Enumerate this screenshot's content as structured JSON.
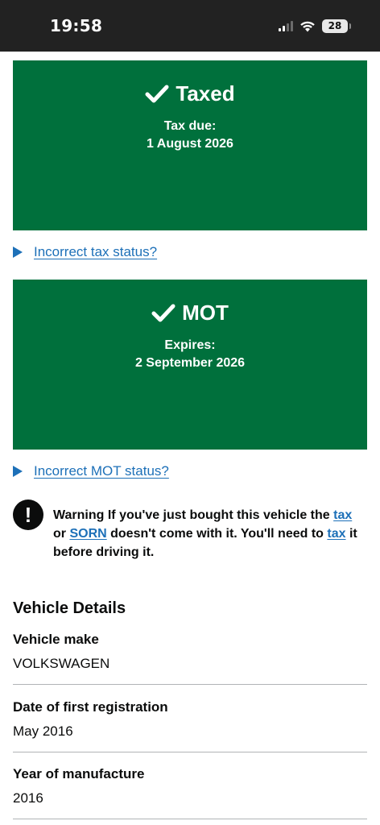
{
  "status_bar": {
    "time": "19:58",
    "battery": "28"
  },
  "tax_panel": {
    "title": "Taxed",
    "label": "Tax due:",
    "date": "1 August 2026"
  },
  "tax_link": "Incorrect tax status?",
  "mot_panel": {
    "title": "MOT",
    "label": "Expires:",
    "date": "2 September 2026"
  },
  "mot_link": "Incorrect MOT status?",
  "warning": {
    "icon": "!",
    "part1": "Warning If you've just bought this vehicle the ",
    "link_tax1": "tax",
    "part2": " or ",
    "link_sorn": "SORN",
    "part3": " doesn't come with it. You'll need to ",
    "link_tax2": "tax",
    "part4": " it before driving it."
  },
  "vehicle_details": {
    "title": "Vehicle Details",
    "rows": [
      {
        "label": "Vehicle make",
        "value": "VOLKSWAGEN"
      },
      {
        "label": "Date of first registration",
        "value": "May 2016"
      },
      {
        "label": "Year of manufacture",
        "value": "2016"
      }
    ]
  },
  "colors": {
    "panel_green": "#00703c",
    "link_blue": "#1d70b8",
    "text": "#0b0c0c"
  }
}
